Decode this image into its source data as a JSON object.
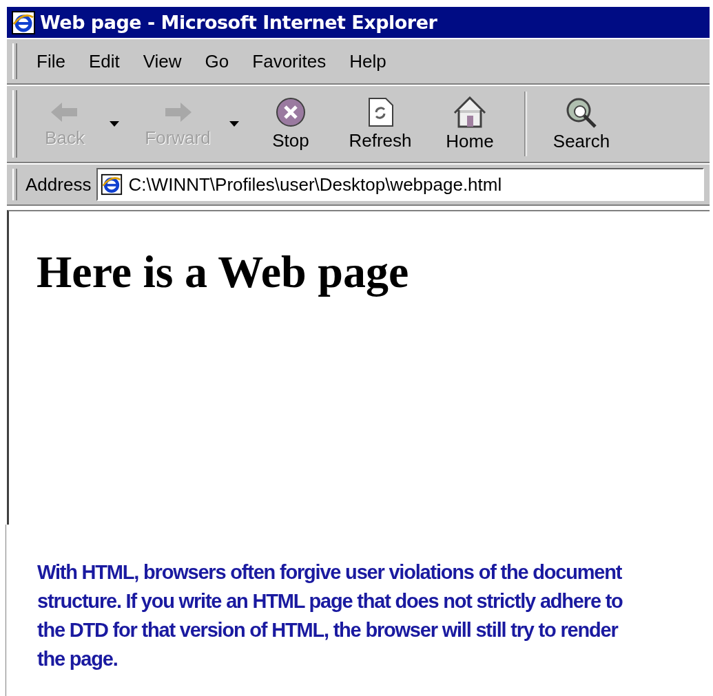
{
  "window": {
    "title": "Web page - Microsoft Internet Explorer"
  },
  "menu": [
    {
      "label": "File"
    },
    {
      "label": "Edit"
    },
    {
      "label": "View"
    },
    {
      "label": "Go"
    },
    {
      "label": "Favorites"
    },
    {
      "label": "Help"
    }
  ],
  "toolbar": [
    {
      "kind": "back",
      "label": "Back",
      "disabled": true,
      "dropdown": true
    },
    {
      "kind": "forward",
      "label": "Forward",
      "disabled": true,
      "dropdown": true
    },
    {
      "kind": "stop",
      "label": "Stop",
      "disabled": false,
      "dropdown": false
    },
    {
      "kind": "refresh",
      "label": "Refresh",
      "disabled": false,
      "dropdown": false
    },
    {
      "kind": "home",
      "label": "Home",
      "disabled": false,
      "dropdown": false
    },
    {
      "kind": "search",
      "label": "Search",
      "disabled": false,
      "dropdown": false
    }
  ],
  "address": {
    "label": "Address",
    "value": "C:\\WINNT\\Profiles\\user\\Desktop\\webpage.html"
  },
  "content": {
    "heading": "Here is a Web page"
  },
  "caption": "With HTML, browsers often forgive user violations of the document structure. If you write an HTML page that does not strictly adhere to the DTD for that version of HTML, the browser will still try to render the page."
}
